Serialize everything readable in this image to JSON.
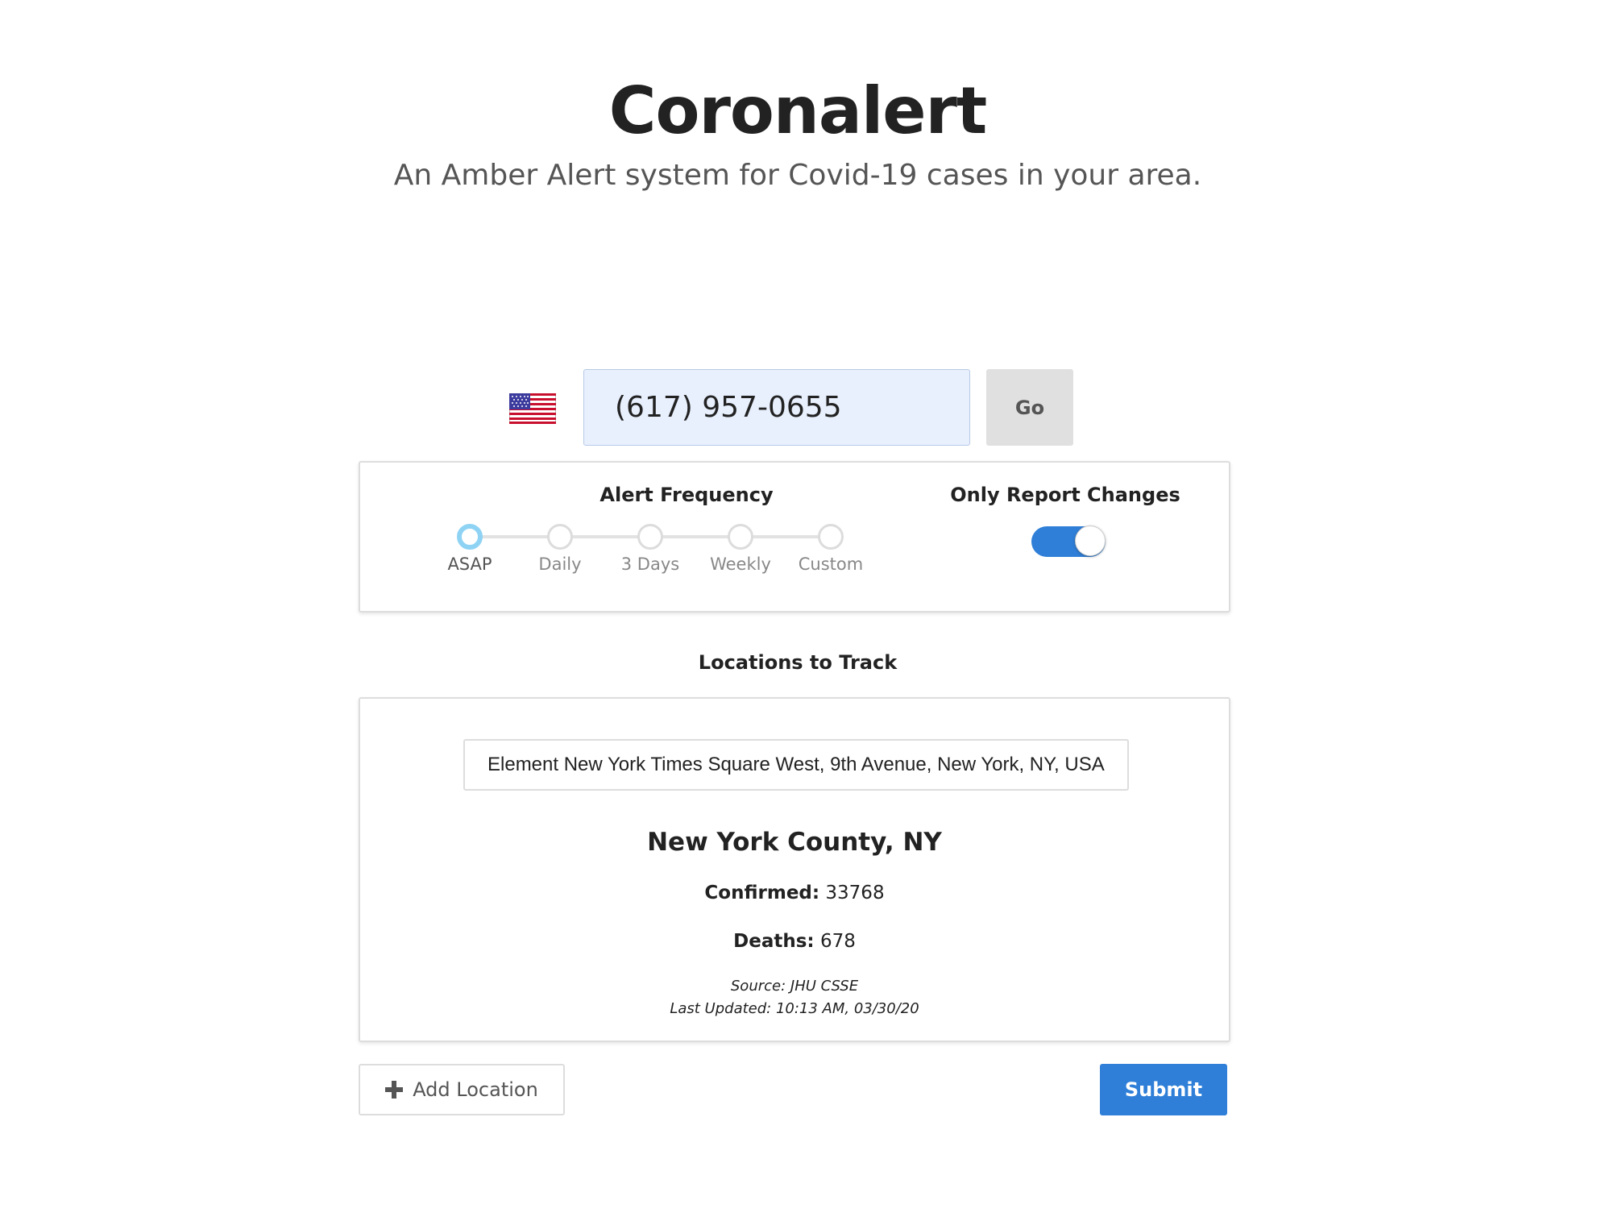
{
  "header": {
    "title": "Coronalert",
    "subtitle": "An Amber Alert system for Covid-19 cases in your area."
  },
  "phone": {
    "country_icon": "us-flag-icon",
    "value": "(617) 957-0655",
    "go_label": "Go"
  },
  "settings": {
    "frequency": {
      "heading": "Alert Frequency",
      "options": [
        {
          "label": "ASAP",
          "selected": true
        },
        {
          "label": "Daily",
          "selected": false
        },
        {
          "label": "3 Days",
          "selected": false
        },
        {
          "label": "Weekly",
          "selected": false
        },
        {
          "label": "Custom",
          "selected": false
        }
      ]
    },
    "changes": {
      "heading": "Only Report Changes",
      "enabled": true
    }
  },
  "locations": {
    "heading": "Locations to Track",
    "items": [
      {
        "query": "Element New York Times Square West, 9th Avenue, New York, NY, USA",
        "county": "New York County, NY",
        "confirmed_label": "Confirmed:",
        "confirmed_value": "33768",
        "deaths_label": "Deaths:",
        "deaths_value": "678",
        "source": "Source: JHU CSSE",
        "updated": "Last Updated: 10:13 AM, 03/30/20"
      }
    ]
  },
  "actions": {
    "add_location_label": "Add Location",
    "submit_label": "Submit"
  },
  "colors": {
    "accent": "#2f7fd8",
    "input_fill": "#e8f0fe",
    "active_step": "#8fd3f4"
  }
}
